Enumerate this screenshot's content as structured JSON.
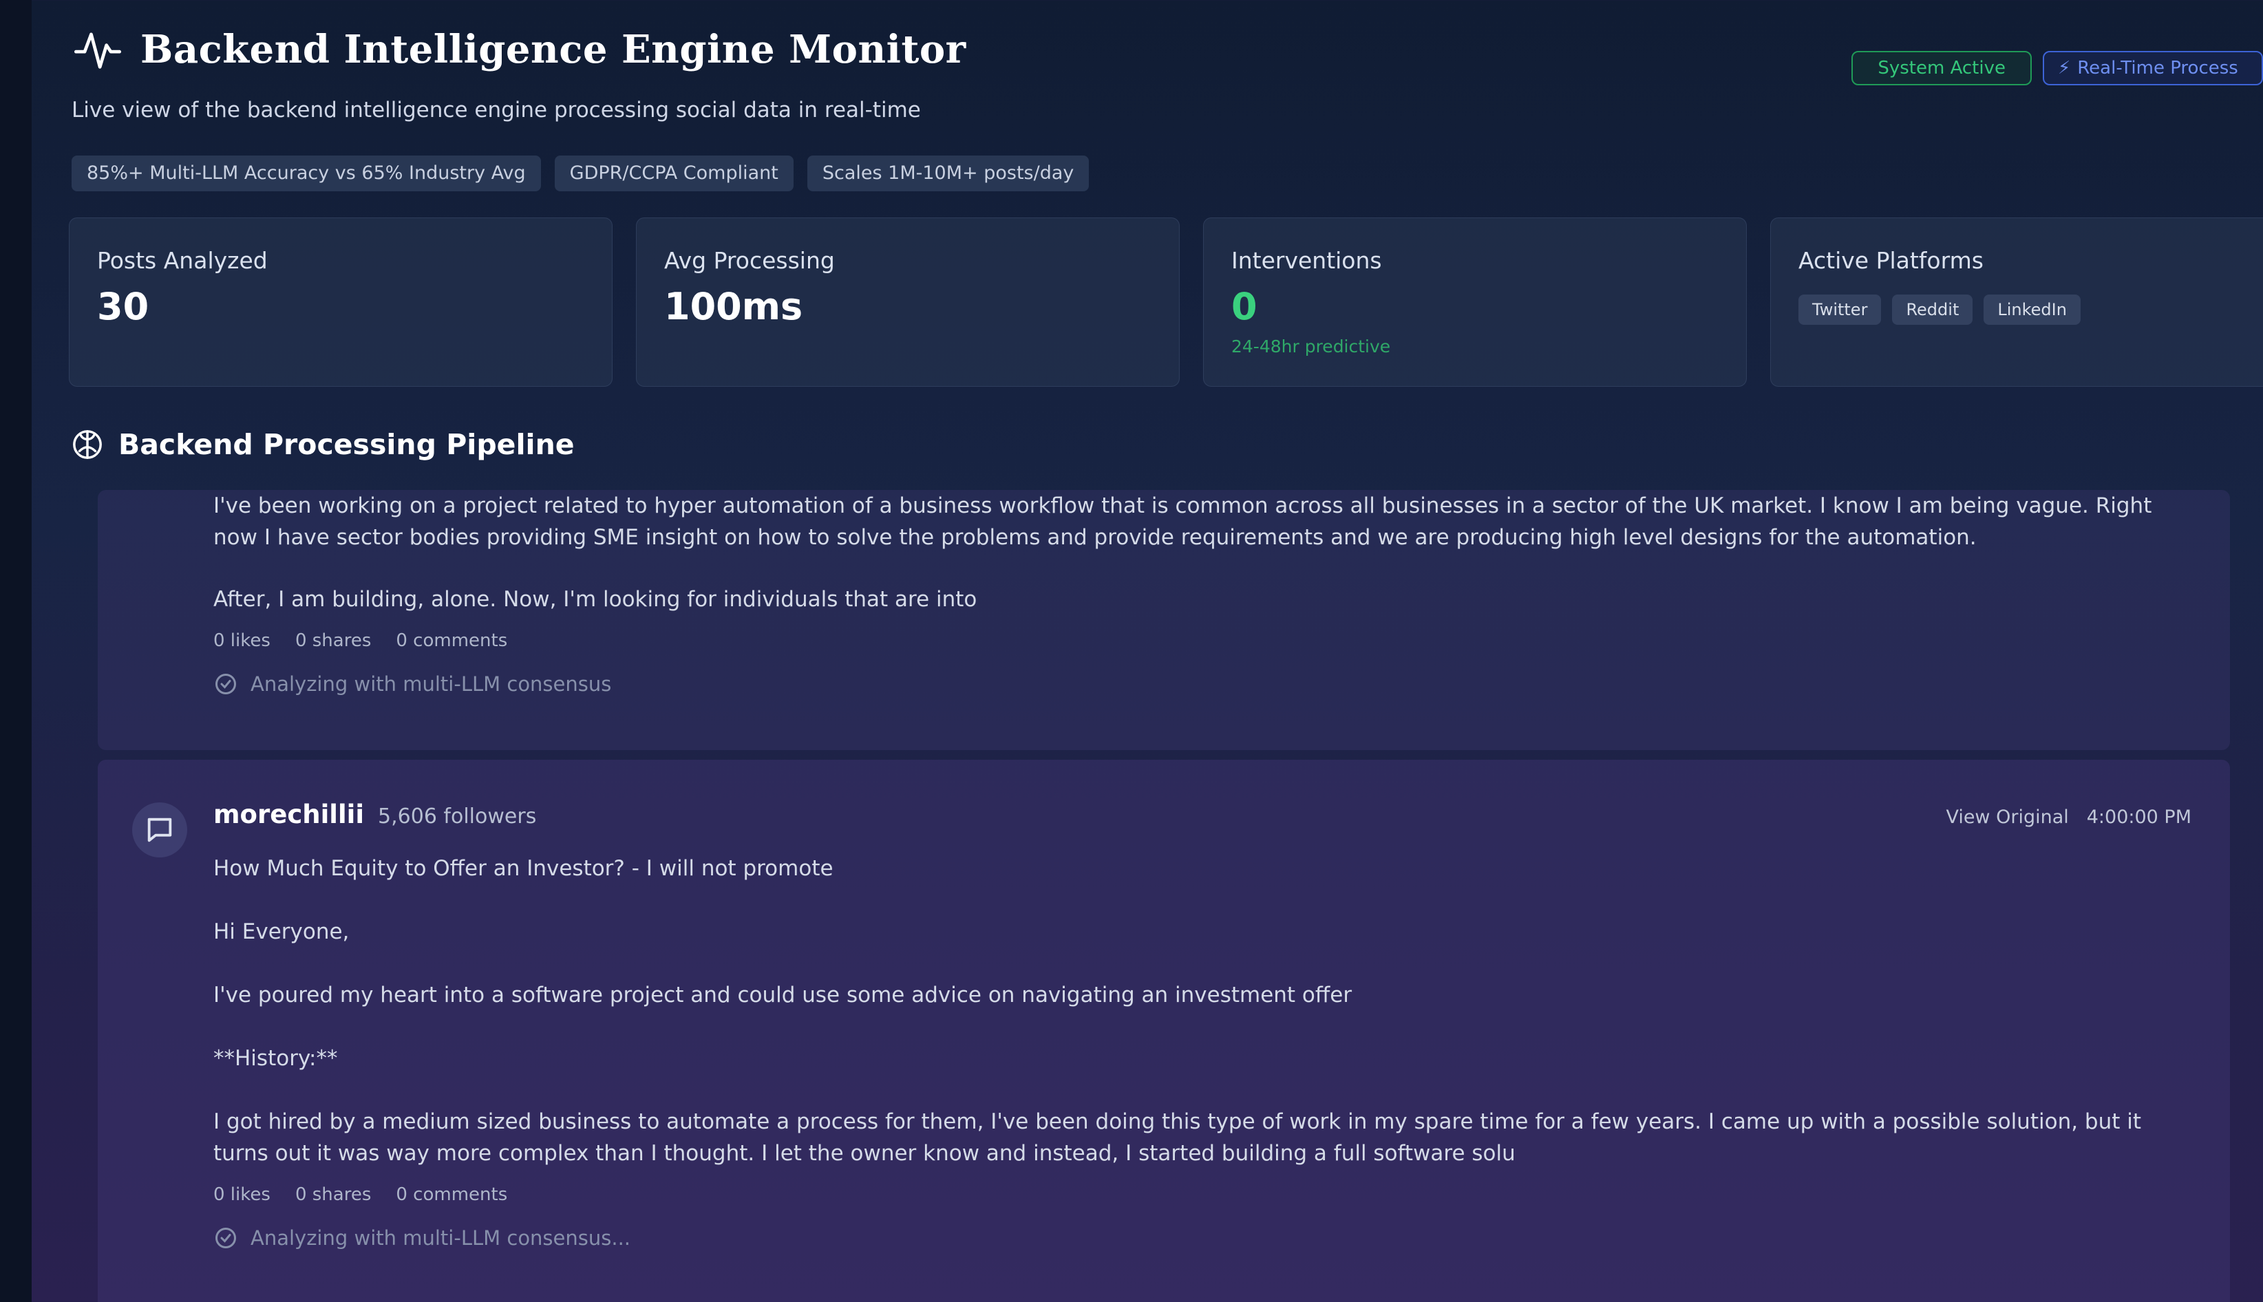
{
  "header": {
    "title": "Backend Intelligence Engine Monitor",
    "subtitle": "Live view of the backend intelligence engine processing social data in real-time",
    "status_badges": [
      "System Active",
      "Real-Time Process"
    ],
    "tags": [
      "85%+ Multi-LLM Accuracy vs 65% Industry Avg",
      "GDPR/CCPA Compliant",
      "Scales 1M-10M+ posts/day"
    ]
  },
  "stats": {
    "posts_analyzed": {
      "label": "Posts Analyzed",
      "value": "30"
    },
    "avg_processing": {
      "label": "Avg Processing",
      "value": "100ms"
    },
    "interventions": {
      "label": "Interventions",
      "value": "0",
      "note": "24-48hr predictive"
    },
    "active_platforms": {
      "label": "Active Platforms",
      "platforms": [
        "Twitter",
        "Reddit",
        "LinkedIn"
      ]
    }
  },
  "pipeline": {
    "title": "Backend Processing Pipeline",
    "posts": [
      {
        "paragraphs": [
          "I've been working on a project related to hyper automation of a business workflow that is common across all businesses in a sector of the UK market. I know I am being vague. Right now I have sector bodies providing SME insight on how to solve the problems and provide requirements and we are producing high level designs for the automation.",
          "After, I am building, alone. Now, I'm looking for individuals that are into"
        ],
        "likes": "0 likes",
        "shares": "0 shares",
        "comments": "0 comments",
        "status": "Analyzing with multi-LLM consensus"
      },
      {
        "author": "morechillii",
        "followers": "5,606 followers",
        "view_original": "View Original",
        "time": "4:00:00 PM",
        "paragraphs": [
          "How Much Equity to Offer an Investor? - I will not promote",
          "Hi Everyone,",
          "I've poured my heart into a software project and could use some advice on navigating an investment offer",
          "**History:**",
          "I got hired by a medium sized business to automate a process for them, I've been doing this type of work in my spare time for a few years. I came up with a possible solution, but it turns out it was way more complex than I thought. I let the owner know and instead, I started building a full software solu"
        ],
        "likes": "0 likes",
        "shares": "0 shares",
        "comments": "0 comments",
        "status": "Analyzing with multi-LLM consensus..."
      }
    ]
  }
}
